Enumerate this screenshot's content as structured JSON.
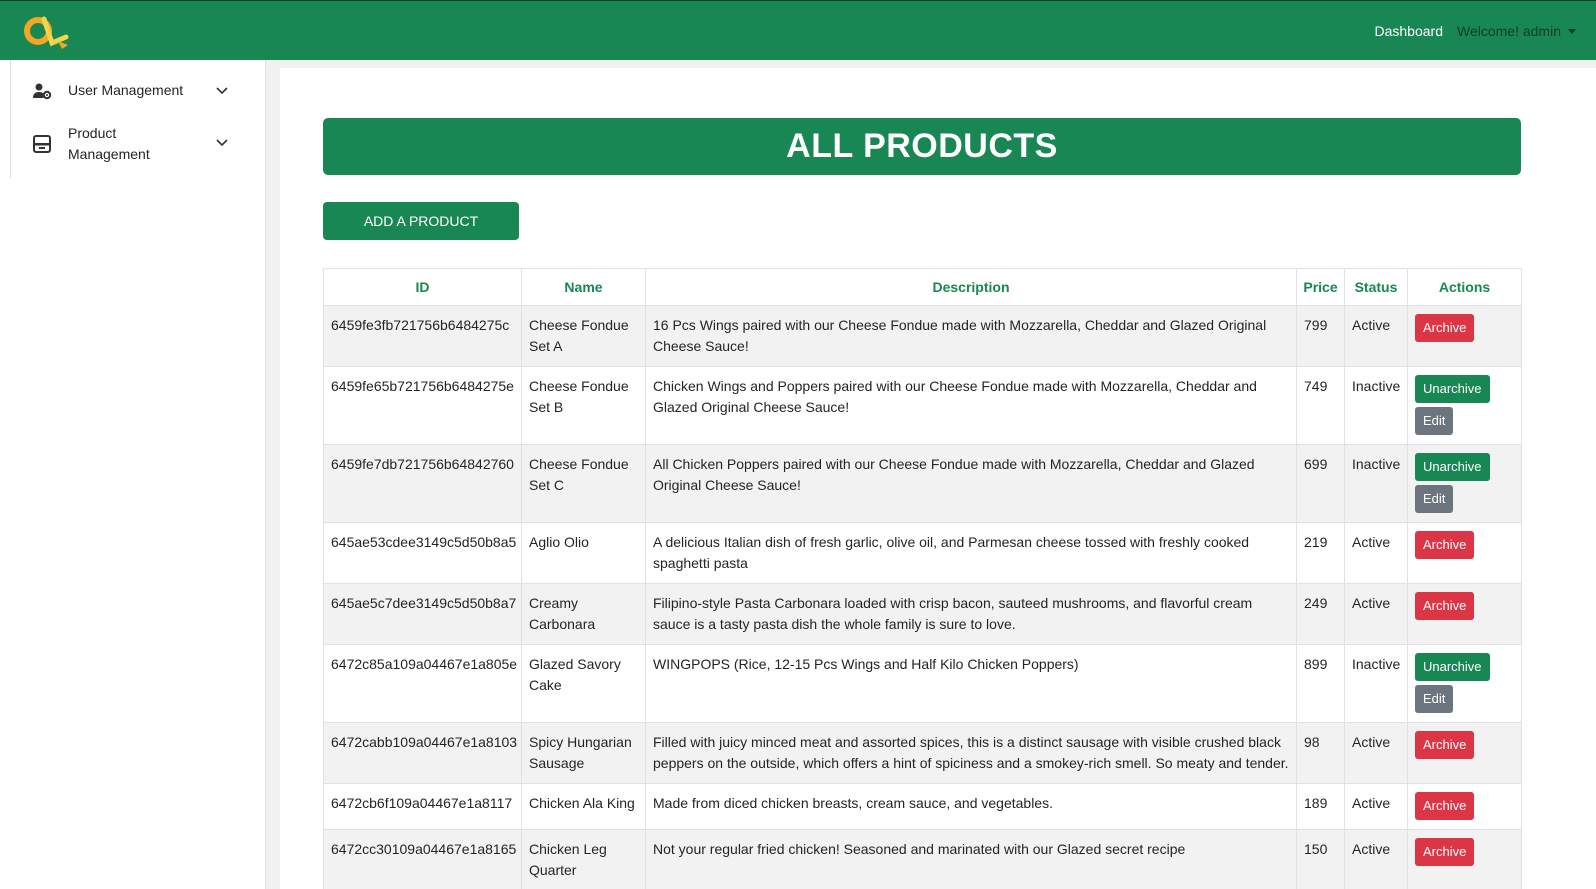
{
  "nav": {
    "dashboard_label": "Dashboard",
    "welcome_label": "Welcome! admin"
  },
  "sidebar": {
    "items": [
      {
        "label": "User Management",
        "icon": "user-gear-icon"
      },
      {
        "label": "Product Management",
        "icon": "inbox-icon"
      }
    ]
  },
  "page": {
    "title": "ALL PRODUCTS",
    "add_button_label": "ADD A PRODUCT"
  },
  "table": {
    "headers": [
      "ID",
      "Name",
      "Description",
      "Price",
      "Status",
      "Actions"
    ],
    "rows": [
      {
        "id": "6459fe3fb721756b6484275c",
        "name": "Cheese Fondue Set A",
        "description": "16 Pcs Wings paired with our Cheese Fondue made with Mozzarella, Cheddar and Glazed Original Cheese Sauce!",
        "price": "799",
        "status": "Active",
        "actions": [
          "Archive"
        ]
      },
      {
        "id": "6459fe65b721756b6484275e",
        "name": "Cheese Fondue Set B",
        "description": "Chicken Wings and Poppers paired with our Cheese Fondue made with Mozzarella, Cheddar and Glazed Original Cheese Sauce!",
        "price": "749",
        "status": "Inactive",
        "actions": [
          "Unarchive",
          "Edit"
        ]
      },
      {
        "id": "6459fe7db721756b64842760",
        "name": "Cheese Fondue Set C",
        "description": "All Chicken Poppers paired with our Cheese Fondue made with Mozzarella, Cheddar and Glazed Original Cheese Sauce!",
        "price": "699",
        "status": "Inactive",
        "actions": [
          "Unarchive",
          "Edit"
        ]
      },
      {
        "id": "645ae53cdee3149c5d50b8a5",
        "name": "Aglio Olio",
        "description": "A delicious Italian dish of fresh garlic, olive oil, and Parmesan cheese tossed with freshly cooked spaghetti pasta",
        "price": "219",
        "status": "Active",
        "actions": [
          "Archive"
        ]
      },
      {
        "id": "645ae5c7dee3149c5d50b8a7",
        "name": "Creamy Carbonara",
        "description": "Filipino-style Pasta Carbonara loaded with crisp bacon, sauteed mushrooms, and flavorful cream sauce is a tasty pasta dish the whole family is sure to love.",
        "price": "249",
        "status": "Active",
        "actions": [
          "Archive"
        ]
      },
      {
        "id": "6472c85a109a04467e1a805e",
        "name": "Glazed Savory Cake",
        "description": "WINGPOPS (Rice, 12-15 Pcs Wings and Half Kilo Chicken Poppers)",
        "price": "899",
        "status": "Inactive",
        "actions": [
          "Unarchive",
          "Edit"
        ]
      },
      {
        "id": "6472cabb109a04467e1a8103",
        "name": "Spicy Hungarian Sausage",
        "description": "Filled with juicy minced meat and assorted spices, this is a distinct sausage with visible crushed black peppers on the outside, which offers a hint of spiciness and a smokey-rich smell. So meaty and tender.",
        "price": "98",
        "status": "Active",
        "actions": [
          "Archive"
        ]
      },
      {
        "id": "6472cb6f109a04467e1a8117",
        "name": "Chicken Ala King",
        "description": "Made from diced chicken breasts, cream sauce, and vegetables.",
        "price": "189",
        "status": "Active",
        "actions": [
          "Archive"
        ]
      },
      {
        "id": "6472cc30109a04467e1a8165",
        "name": "Chicken Leg Quarter",
        "description": "Not your regular fried chicken! Seasoned and marinated with our Glazed secret recipe",
        "price": "150",
        "status": "Active",
        "actions": [
          "Archive"
        ]
      }
    ]
  },
  "colors": {
    "brand_green": "#198754",
    "danger_red": "#dc3545",
    "secondary_gray": "#6c757d"
  }
}
